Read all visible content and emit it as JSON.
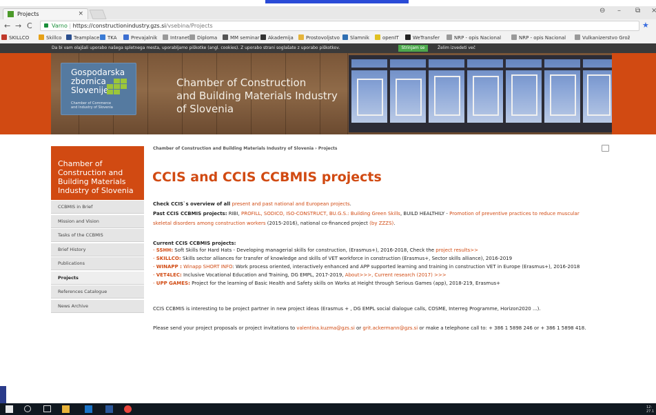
{
  "browser": {
    "tab_title": "Projects",
    "tab_close": "×",
    "window_controls": [
      "⊖",
      "–",
      "⧉",
      "×"
    ],
    "nav": {
      "back": "←",
      "forward": "→",
      "reload": "C"
    },
    "address": {
      "secure_label": "Varno",
      "host": "https://constructionindustry.gzs.si",
      "path": "/vsebina/Projects"
    },
    "bookmarks": [
      {
        "label": "SKILLCO",
        "color": "#c0392b"
      },
      {
        "label": "Skillco",
        "color": "#e6a117"
      },
      {
        "label": "Teamplace",
        "color": "#2b4f8f"
      },
      {
        "label": "TKA",
        "color": "#3a7bd5"
      },
      {
        "label": "Prevajalnik",
        "color": "#3c6fd1"
      },
      {
        "label": "Intranet",
        "color": "#999999"
      },
      {
        "label": "Diploma",
        "color": "#999999"
      },
      {
        "label": "MM seminar",
        "color": "#555555"
      },
      {
        "label": "Akademija",
        "color": "#333333"
      },
      {
        "label": "Prostovoljstvo",
        "color": "#e5b43b"
      },
      {
        "label": "Slamnik",
        "color": "#2f6fb3"
      },
      {
        "label": "openIT",
        "color": "#e0c020"
      },
      {
        "label": "WeTransfer",
        "color": "#222222"
      },
      {
        "label": "NRP - opis Nacional",
        "color": "#999999"
      },
      {
        "label": "NRP - opis Nacional",
        "color": "#999999"
      },
      {
        "label": "Vulkanizerstvo Grož",
        "color": "#999999"
      }
    ]
  },
  "cookie_bar": {
    "text": "Da bi vam olajšali uporabo našega spletnega mesta, uporabljamo piškotke (angl. cookies). Z uporabo strani soglašate z uporabo piškotkov.",
    "accept_label": "Strinjam se",
    "more_label": "Želim izvedeti več"
  },
  "header": {
    "logo_lines": [
      "Gospodarska",
      "zbornica",
      "Slovenije"
    ],
    "logo_small": [
      "Chamber of Commerce",
      "and Industry of Slovenia"
    ],
    "title_lines": [
      "Chamber of Construction",
      "and Building Materials Industry",
      "of Slovenia"
    ]
  },
  "sidebar": {
    "heading": "Chamber of Construction and Building Materials Industry of Slovenia",
    "items": [
      {
        "label": "CCBMIS in Brief",
        "active": false
      },
      {
        "label": "Mission and Vision",
        "active": false
      },
      {
        "label": "Tasks of the CCBMIS",
        "active": false
      },
      {
        "label": "Brief History",
        "active": false
      },
      {
        "label": "Publications",
        "active": false
      },
      {
        "label": "Projects",
        "active": true
      },
      {
        "label": "References Catalogue",
        "active": false
      },
      {
        "label": "News Archive",
        "active": false
      }
    ]
  },
  "content": {
    "breadcrumb": "Chamber of Construction and Building Materials Industry of Slovenia › Projects",
    "title": "CCIS and CCIS CCBMIS projects",
    "check_pre": "Check CCIS`s overview of all ",
    "check_link": "present and past national and European projects",
    "check_post": ".",
    "past_label": "Past CCIS CCBMIS projects:",
    "past_pre": " RIBI, ",
    "past_links": "PROFILL, SODICO, ISO-CONSTRUCT, BU.G.S.: Building Green Skills",
    "past_mid": ",  BUILD HEALTHILY - ",
    "past_link2": "Promotion of preventive practices to reduce muscular",
    "past_link3": "skeletal disorders among construction workers",
    "past_tail": " (2015-2016), national co-financed project ",
    "past_link4": "(by ZZZS)",
    "past_end": ".",
    "current_label": "Current CCIS CCBMIS projects:",
    "current": [
      {
        "name": "SSHH:",
        "pre": " Soft Skills for Hard Hats - Developing managerial skills for construction, (Erasmus+), 2016-2018, Check the ",
        "link": "project results>>",
        "post": ""
      },
      {
        "name": "SKILLCO:",
        "pre": " Skills sector alliances for transfer of knowledge and skills of VET workforce in construction (Erasmus+, Sector skills alliance), 2016-2019",
        "link": "",
        "post": ""
      },
      {
        "name": "WINAPP :",
        "pre": " ",
        "link": "Winapp SHORT INFO",
        "post": ": Work process oriented, interactively enhanced and APP supported learning and training in construction VET in Europe (Erasmus+), 2016-2018"
      },
      {
        "name": "VET4LEC:",
        "pre": " Inclusive Vocational Education and Training, DG EMPL, 2017-2019, ",
        "link": "About>>>, Current research (2017) >>>",
        "post": ""
      },
      {
        "name": "UPP GAMES:",
        "pre": " Project for the learning of Basic Health and Safety skills on Works at Height through Serious Games (app), 2018-219, Erasmus+",
        "link": "",
        "post": ""
      }
    ],
    "partner_text": "CCIS CCBMIS is interesting to be project partner in new project ideas (Erasmus + , DG EMPL social dialogue calls, COSME, Interreg Programme, Horizon2020 ...).",
    "send_pre": "Please send your project proposals or project invitations to ",
    "email1": "valentina.kuzma@gzs.si",
    "send_or": " or ",
    "email2": "grit.ackermann@gzs.si",
    "send_post": " or make a telephone call to: + 386 1 5898 246 or + 386 1 5898 418."
  },
  "taskbar": {
    "clock_time": "12:",
    "clock_date": "27.1"
  },
  "colors": {
    "accent": "#d14a12",
    "link": "#d14a12"
  }
}
